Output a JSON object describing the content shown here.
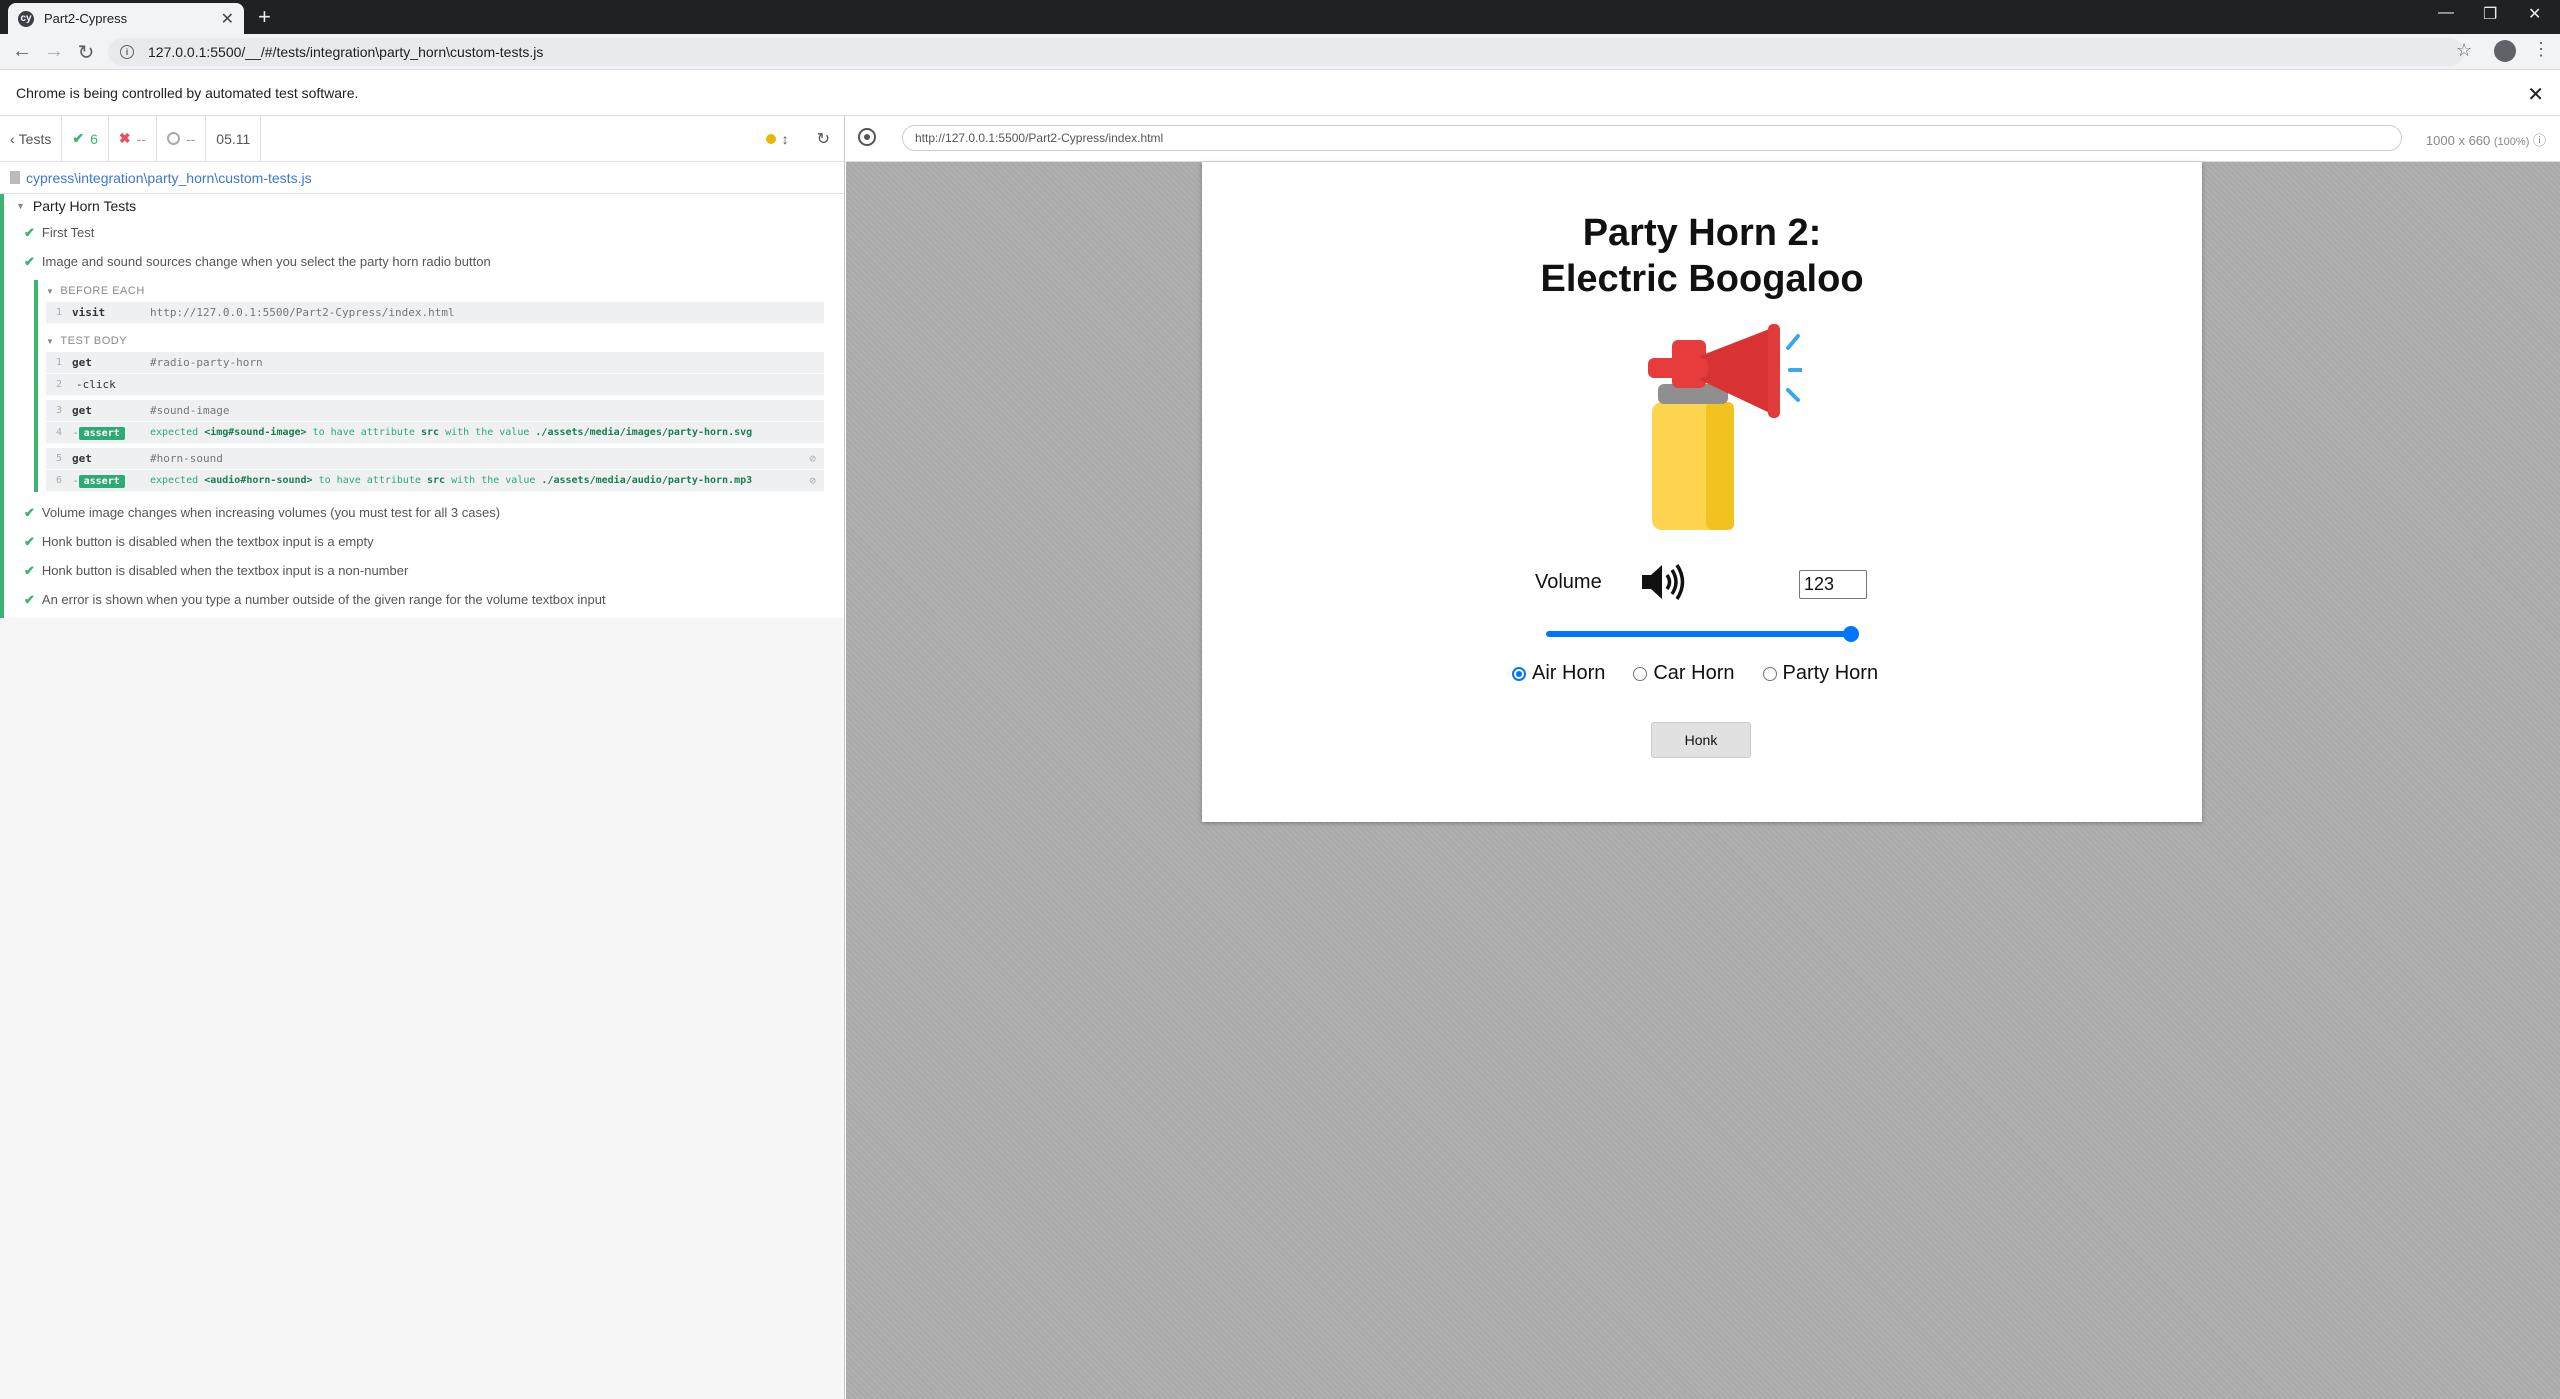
{
  "browser": {
    "tab_title": "Part2-Cypress",
    "url": "127.0.0.1:5500/__/#/tests/integration\\party_horn\\custom-tests.js",
    "automation_notice": "Chrome is being controlled by automated test software."
  },
  "reporter": {
    "tests_label": "Tests",
    "passed": "6",
    "failed": "--",
    "pending": "--",
    "duration": "05.11",
    "spec_path": "cypress\\integration\\party_horn\\custom-tests.js",
    "suite_title": "Party Horn Tests",
    "tests": [
      "First Test",
      "Image and sound sources change when you select the party horn radio button",
      "Volume image changes when increasing volumes (you must test for all 3 cases)",
      "Honk button is disabled when the textbox input is a empty",
      "Honk button is disabled when the textbox input is a non-number",
      "An error is shown when you type a number outside of the given range for the volume textbox input"
    ],
    "before_each_label": "BEFORE EACH",
    "test_body_label": "TEST BODY",
    "before_each_cmds": [
      {
        "num": "1",
        "name": "visit",
        "msg": "http://127.0.0.1:5500/Part2-Cypress/index.html"
      }
    ],
    "body_cmds": [
      {
        "num": "1",
        "name": "get",
        "msg": "#radio-party-horn"
      },
      {
        "num": "2",
        "name": "-click",
        "msg": ""
      },
      {
        "num": "3",
        "name": "get",
        "msg": "#sound-image"
      },
      {
        "num": "4",
        "badge": "assert",
        "expected": "expected",
        "subject": "<img#sound-image>",
        "rel": "to have attribute",
        "attr": "src",
        "with": "with the value",
        "value": "./assets/media/images/party-horn.svg"
      },
      {
        "num": "5",
        "name": "get",
        "msg": "#horn-sound"
      },
      {
        "num": "6",
        "badge": "assert",
        "expected": "expected",
        "subject": "<audio#horn-sound>",
        "rel": "to have attribute",
        "attr": "src",
        "with": "with the value",
        "value": "./assets/media/audio/party-horn.mp3"
      }
    ]
  },
  "aut": {
    "url": "http://127.0.0.1:5500/Part2-Cypress/index.html",
    "size": "1000 x 660",
    "scale": "(100%)"
  },
  "page": {
    "title_line1": "Party Horn 2:",
    "title_line2": "Electric Boogaloo",
    "volume_label": "Volume",
    "volume_value": "123",
    "volume_slider_level": 1.0,
    "radios": [
      {
        "label": "Air Horn",
        "checked": true
      },
      {
        "label": "Car Horn",
        "checked": false
      },
      {
        "label": "Party Horn",
        "checked": false
      }
    ],
    "honk_label": "Honk"
  },
  "colors": {
    "pass": "#3cb371",
    "fail": "#e94f5f",
    "link": "#3c78d8",
    "slider": "#0075ff"
  }
}
